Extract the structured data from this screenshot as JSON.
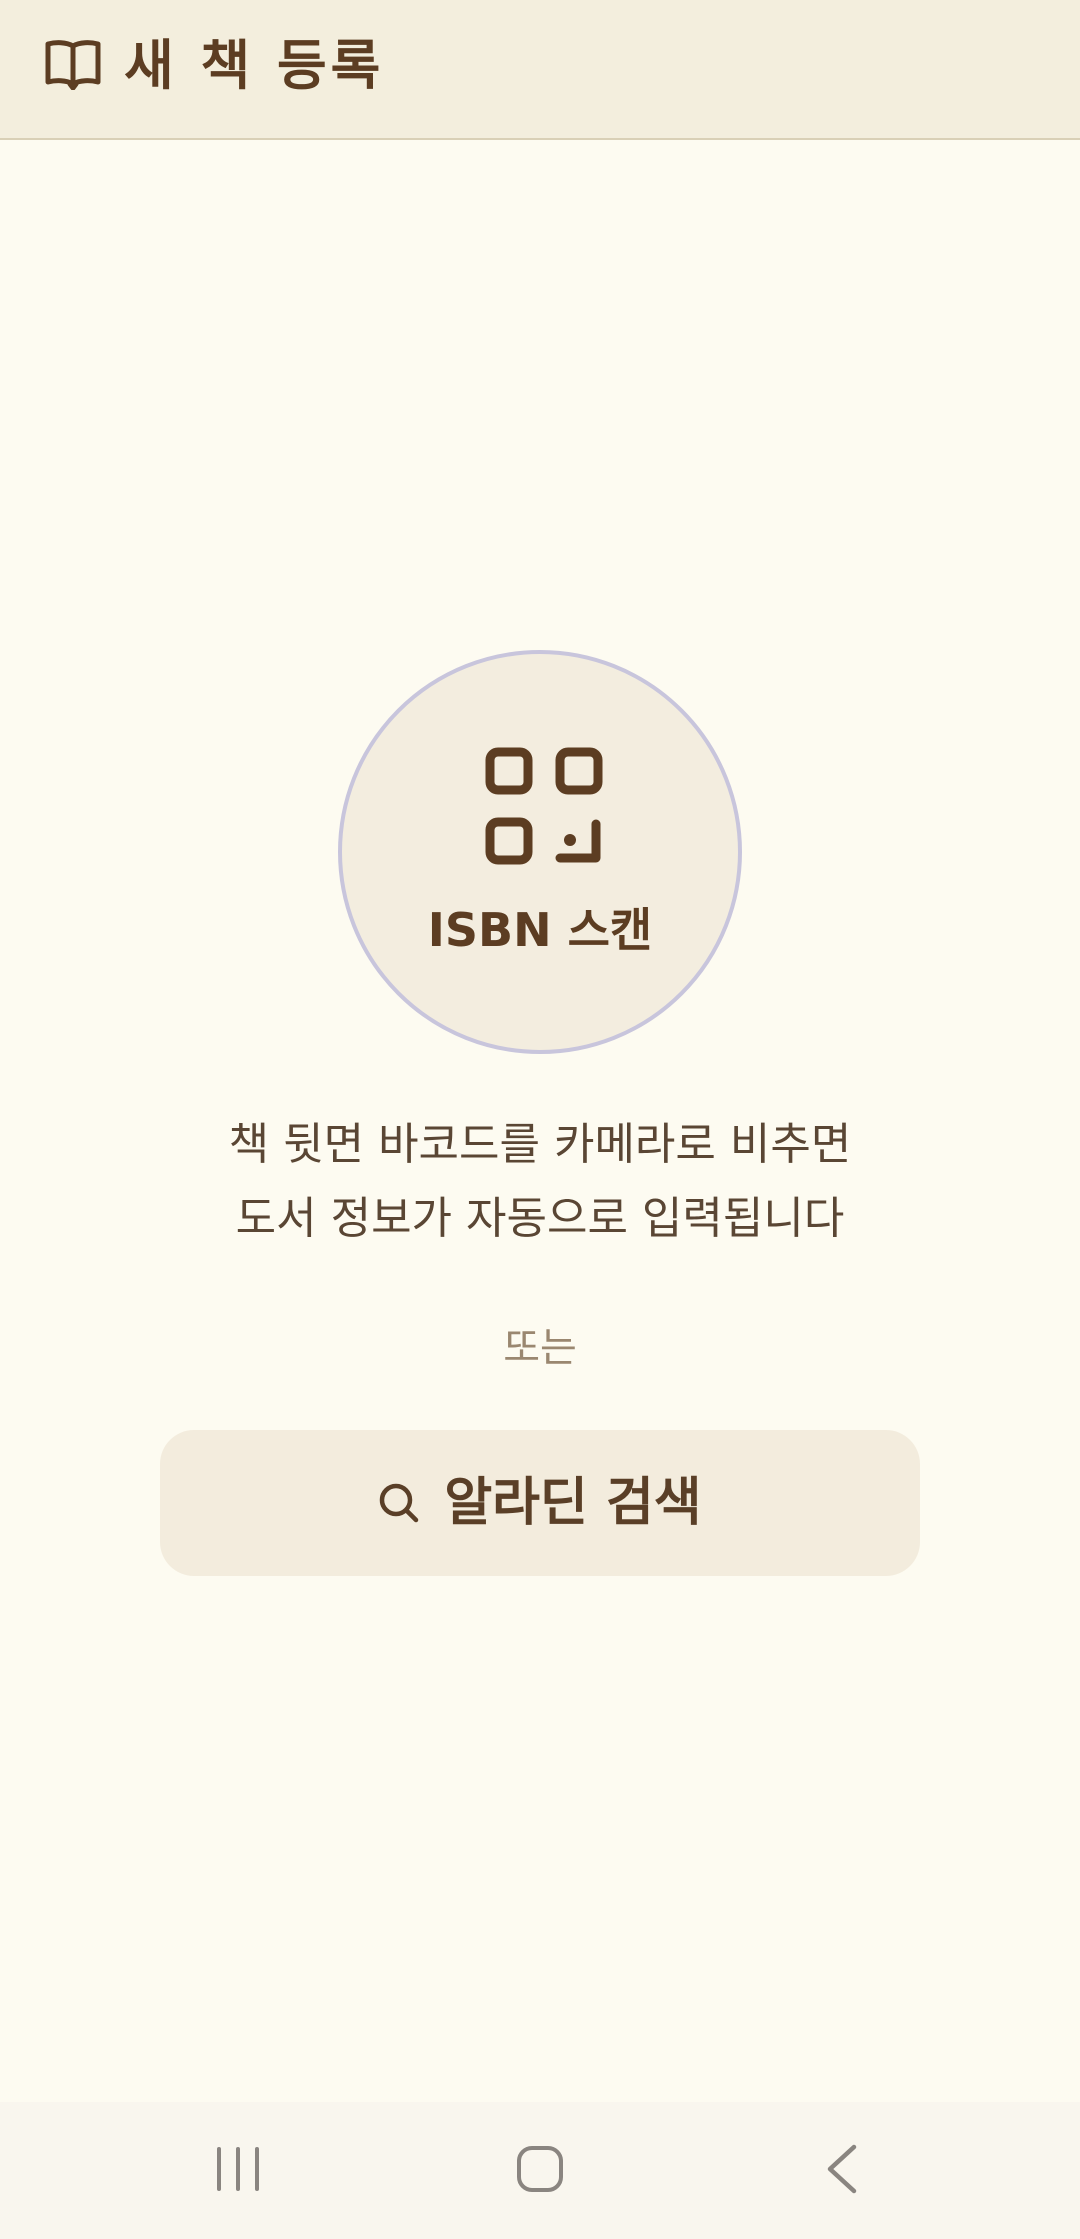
{
  "header": {
    "title": "새 책 등록",
    "icon": "book-open-icon"
  },
  "scan": {
    "label": "ISBN 스캔",
    "icon": "qr-code-icon"
  },
  "description": {
    "line1": "책 뒷면 바코드를 카메라로 비추면",
    "line2": "도서 정보가 자동으로 입력됩니다"
  },
  "divider_text": "또는",
  "search_button": {
    "label": "알라딘 검색",
    "icon": "search-icon"
  },
  "nav": {
    "recent_icon": "recent-apps-icon",
    "home_icon": "home-icon",
    "back_icon": "back-icon"
  },
  "colors": {
    "accent": "#5c3d22",
    "background": "#fdfbf1",
    "header_bg": "#f3eedd",
    "circle_border": "#c8c5dc"
  }
}
